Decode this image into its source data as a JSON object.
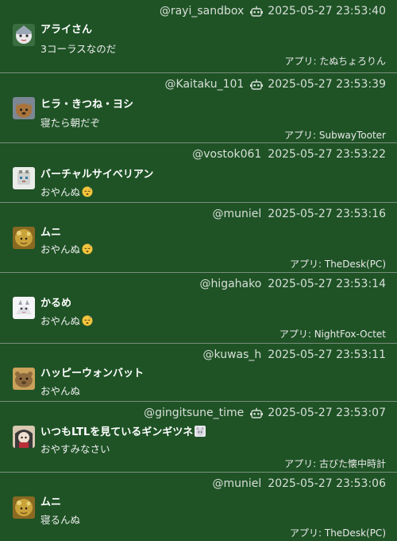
{
  "posts": [
    {
      "acct": "@rayi_sandbox",
      "bot": true,
      "time": "2025-05-27 23:53:40",
      "name": "アライさん",
      "content": "3コーラスなのだ",
      "app": "アプリ: たぬちょろりん",
      "avatar_colors": [
        "#9aa7b6",
        "#e8e8ea",
        "#3a6d3f"
      ]
    },
    {
      "acct": "@Kaitaku_101",
      "bot": true,
      "time": "2025-05-27 23:53:39",
      "name": "ヒラ・きつね・ヨシ",
      "content": "寝たら朝だぞ",
      "app": "アプリ: SubwayTooter",
      "avatar_colors": [
        "#7b8794",
        "#a8743c",
        "#3d4652"
      ]
    },
    {
      "acct": "@vostok061",
      "bot": false,
      "time": "2025-05-27 23:53:22",
      "name": "バーチャルサイベリアン",
      "content": "おやんぬ",
      "content_emoji": "sleeping-face",
      "app": "",
      "avatar_colors": [
        "#cfd2cf",
        "#8c8f88",
        "#e9ece8"
      ]
    },
    {
      "acct": "@muniel",
      "bot": false,
      "time": "2025-05-27 23:53:16",
      "name": "ムニ",
      "content": "おやんぬ",
      "content_emoji": "sleeping-face",
      "app": "アプリ: TheDesk(PC)",
      "avatar_colors": [
        "#c9a33a",
        "#8a6a22",
        "#e8d27a"
      ]
    },
    {
      "acct": "@higahako",
      "bot": false,
      "time": "2025-05-27 23:53:14",
      "name": "かるめ",
      "content": "おやんぬ",
      "content_emoji": "sleeping-face",
      "app": "アプリ: NightFox-Octet",
      "avatar_colors": [
        "#e3e3e6",
        "#9fa3ab",
        "#f5f5f7"
      ]
    },
    {
      "acct": "@kuwas_h",
      "bot": false,
      "time": "2025-05-27 23:53:11",
      "name": "ハッピーウォンバット",
      "content": "おやんぬ",
      "app": "",
      "avatar_colors": [
        "#8e6a3e",
        "#caa25a",
        "#5a4026"
      ]
    },
    {
      "acct": "@gingitsune_time",
      "bot": true,
      "time": "2025-05-27 23:53:07",
      "name": "いつもLTLを見ているギンギツネ",
      "name_emoji": "fox-character",
      "content": "おやすみなさい",
      "app": "アプリ: 古びた懐中時計",
      "avatar_colors": [
        "#b8303a",
        "#3a3a3a",
        "#d8c8b0"
      ]
    },
    {
      "acct": "@muniel",
      "bot": false,
      "time": "2025-05-27 23:53:06",
      "name": "ムニ",
      "content": "寝るんぬ",
      "app": "アプリ: TheDesk(PC)",
      "avatar_colors": [
        "#c9a33a",
        "#8a6a22",
        "#e8d27a"
      ]
    }
  ],
  "colors": {
    "background": "#1f5326",
    "divider": "#7a8f7c",
    "text": "#f2f2f2",
    "muted": "#d8dfd8"
  }
}
